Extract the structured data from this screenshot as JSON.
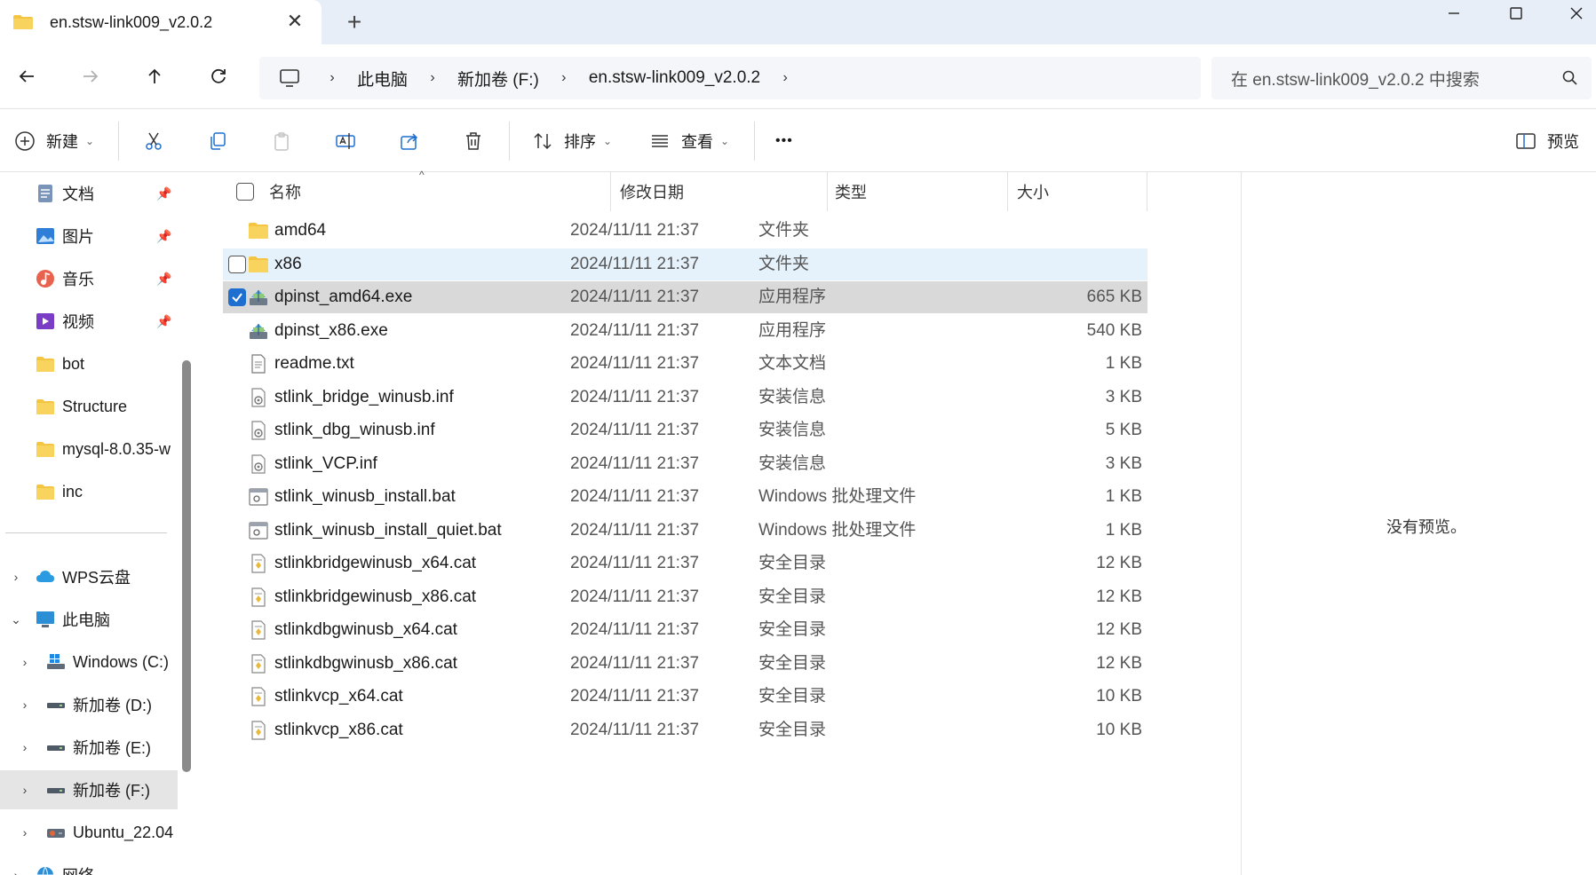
{
  "tab": {
    "title": "en.stsw-link009_v2.0.2",
    "close": "✕",
    "new_tab": "+"
  },
  "window": {
    "minimize": "—",
    "maximize": "☐",
    "close": "✕"
  },
  "nav": {
    "back": "←",
    "forward": "→",
    "up": "↑",
    "refresh": "⟳"
  },
  "breadcrumb": [
    "此电脑",
    "新加卷 (F:)",
    "en.stsw-link009_v2.0.2"
  ],
  "search": {
    "placeholder": "在 en.stsw-link009_v2.0.2 中搜索"
  },
  "toolbar": {
    "new_label": "新建",
    "sort_label": "排序",
    "view_label": "查看",
    "more": "•••",
    "preview_label": "预览"
  },
  "sidebar": {
    "quick": [
      {
        "label": "文档",
        "icon": "document-icon",
        "pin": "📌"
      },
      {
        "label": "图片",
        "icon": "pictures-icon",
        "pin": "📌"
      },
      {
        "label": "音乐",
        "icon": "music-icon",
        "pin": "📌"
      },
      {
        "label": "视频",
        "icon": "video-icon",
        "pin": "📌"
      },
      {
        "label": "bot",
        "icon": "folder-icon"
      },
      {
        "label": "Structure",
        "icon": "folder-icon"
      },
      {
        "label": "mysql-8.0.35-w",
        "icon": "folder-icon"
      },
      {
        "label": "inc",
        "icon": "folder-icon"
      }
    ],
    "tree": [
      {
        "label": "WPS云盘",
        "icon": "cloud-icon",
        "expander": "›"
      },
      {
        "label": "此电脑",
        "icon": "this-pc-icon",
        "expander": "⌄"
      },
      {
        "label": "Windows (C:)",
        "icon": "windows-drive-icon",
        "expander": "›"
      },
      {
        "label": "新加卷 (D:)",
        "icon": "drive-icon",
        "expander": "›"
      },
      {
        "label": "新加卷 (E:)",
        "icon": "drive-icon",
        "expander": "›"
      },
      {
        "label": "新加卷 (F:)",
        "icon": "drive-icon",
        "expander": "›"
      },
      {
        "label": "Ubuntu_22.04",
        "icon": "linux-drive-icon",
        "expander": "›"
      },
      {
        "label": "网络",
        "icon": "network-icon",
        "expander": "›"
      }
    ]
  },
  "columns": {
    "name": "名称",
    "date": "修改日期",
    "type": "类型",
    "size": "大小",
    "sort_indicator": "^"
  },
  "files": [
    {
      "name": "amd64",
      "date": "2024/11/11 21:37",
      "type": "文件夹",
      "size": "",
      "icon": "folder-icon"
    },
    {
      "name": "x86",
      "date": "2024/11/11 21:37",
      "type": "文件夹",
      "size": "",
      "icon": "folder-icon"
    },
    {
      "name": "dpinst_amd64.exe",
      "date": "2024/11/11 21:37",
      "type": "应用程序",
      "size": "665 KB",
      "icon": "installer-icon"
    },
    {
      "name": "dpinst_x86.exe",
      "date": "2024/11/11 21:37",
      "type": "应用程序",
      "size": "540 KB",
      "icon": "installer-icon"
    },
    {
      "name": "readme.txt",
      "date": "2024/11/11 21:37",
      "type": "文本文档",
      "size": "1 KB",
      "icon": "text-file-icon"
    },
    {
      "name": "stlink_bridge_winusb.inf",
      "date": "2024/11/11 21:37",
      "type": "安装信息",
      "size": "3 KB",
      "icon": "inf-file-icon"
    },
    {
      "name": "stlink_dbg_winusb.inf",
      "date": "2024/11/11 21:37",
      "type": "安装信息",
      "size": "5 KB",
      "icon": "inf-file-icon"
    },
    {
      "name": "stlink_VCP.inf",
      "date": "2024/11/11 21:37",
      "type": "安装信息",
      "size": "3 KB",
      "icon": "inf-file-icon"
    },
    {
      "name": "stlink_winusb_install.bat",
      "date": "2024/11/11 21:37",
      "type": "Windows 批处理文件",
      "size": "1 KB",
      "icon": "batch-file-icon"
    },
    {
      "name": "stlink_winusb_install_quiet.bat",
      "date": "2024/11/11 21:37",
      "type": "Windows 批处理文件",
      "size": "1 KB",
      "icon": "batch-file-icon"
    },
    {
      "name": "stlinkbridgewinusb_x64.cat",
      "date": "2024/11/11 21:37",
      "type": "安全目录",
      "size": "12 KB",
      "icon": "catalog-file-icon"
    },
    {
      "name": "stlinkbridgewinusb_x86.cat",
      "date": "2024/11/11 21:37",
      "type": "安全目录",
      "size": "12 KB",
      "icon": "catalog-file-icon"
    },
    {
      "name": "stlinkdbgwinusb_x64.cat",
      "date": "2024/11/11 21:37",
      "type": "安全目录",
      "size": "12 KB",
      "icon": "catalog-file-icon"
    },
    {
      "name": "stlinkdbgwinusb_x86.cat",
      "date": "2024/11/11 21:37",
      "type": "安全目录",
      "size": "12 KB",
      "icon": "catalog-file-icon"
    },
    {
      "name": "stlinkvcp_x64.cat",
      "date": "2024/11/11 21:37",
      "type": "安全目录",
      "size": "10 KB",
      "icon": "catalog-file-icon"
    },
    {
      "name": "stlinkvcp_x86.cat",
      "date": "2024/11/11 21:37",
      "type": "安全目录",
      "size": "10 KB",
      "icon": "catalog-file-icon"
    }
  ],
  "row_states": {
    "hovered": "x86",
    "selected": "dpinst_amd64.exe"
  },
  "preview": {
    "message": "没有预览。"
  },
  "colors": {
    "accent": "#1f6fd1",
    "folder": "#f4c542",
    "hover": "#e5f1fb",
    "selected": "#d9d9d9",
    "tabbar": "#e8eef8"
  }
}
